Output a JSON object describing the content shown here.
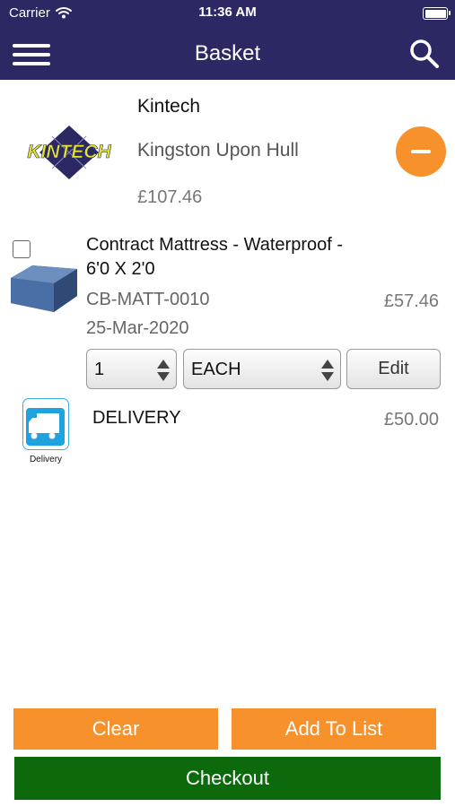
{
  "status_bar": {
    "carrier": "Carrier",
    "time": "11:36 AM"
  },
  "nav": {
    "title": "Basket"
  },
  "store": {
    "name": "Kintech",
    "location": "Kingston Upon Hull",
    "total": "£107.46",
    "logo_text": "KINTECH"
  },
  "items": [
    {
      "name": "Contract Mattress - Waterproof - 6'0 X 2'0",
      "sku": "CB-MATT-0010",
      "date": "25-Mar-2020",
      "price": "£57.46",
      "quantity": "1",
      "unit": "EACH",
      "edit_label": "Edit",
      "selected": false
    }
  ],
  "delivery": {
    "label": "DELIVERY",
    "price": "£50.00",
    "icon_caption": "Delivery"
  },
  "actions": {
    "clear": "Clear",
    "add_to_list": "Add To List",
    "checkout": "Checkout"
  },
  "colors": {
    "header": "#2b2864",
    "accent": "#f6912b",
    "checkout": "#0c6a0c"
  },
  "icons": [
    "wifi-icon",
    "battery-icon",
    "hamburger-menu-icon",
    "search-icon",
    "remove-minus-icon",
    "delivery-truck-icon",
    "stepper-arrows-icon"
  ]
}
